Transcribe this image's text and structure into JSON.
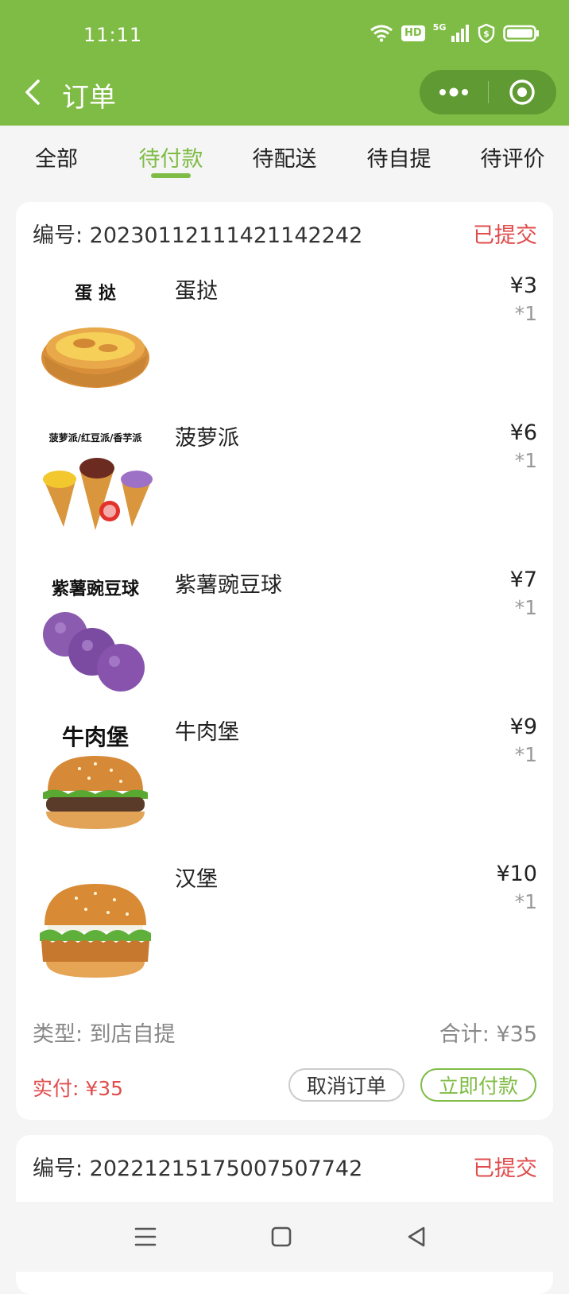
{
  "status_bar": {
    "time": "11:11",
    "hd": "HD",
    "net": "5G"
  },
  "header": {
    "title": "订单"
  },
  "tabs": [
    "全部",
    "待付款",
    "待配送",
    "待自提",
    "待评价"
  ],
  "active_tab": "待付款",
  "orders": [
    {
      "number": "编号:  20230112111421142242",
      "status": "已提交",
      "items": [
        {
          "name": "蛋挞",
          "image_caption": "蛋 挞",
          "price": "¥3",
          "qty": "*1"
        },
        {
          "name": "菠萝派",
          "image_caption": "菠萝派/红豆派/香芋派",
          "price": "¥6",
          "qty": "*1"
        },
        {
          "name": "紫薯豌豆球",
          "image_caption": "紫薯豌豆球",
          "price": "¥7",
          "qty": "*1"
        },
        {
          "name": "牛肉堡",
          "image_caption": "牛肉堡",
          "price": "¥9",
          "qty": "*1"
        },
        {
          "name": "汉堡",
          "image_caption": "",
          "price": "¥10",
          "qty": "*1"
        }
      ],
      "type": "类型: 到店自提",
      "total": "合计: ¥35",
      "paid": "实付: ¥35",
      "cancel_label": "取消订单",
      "pay_label": "立即付款"
    },
    {
      "number": "编号:  20221215175007507742",
      "status": "已提交"
    }
  ],
  "colors": {
    "brand": "#7fbc45",
    "status": "#e04c4c"
  }
}
